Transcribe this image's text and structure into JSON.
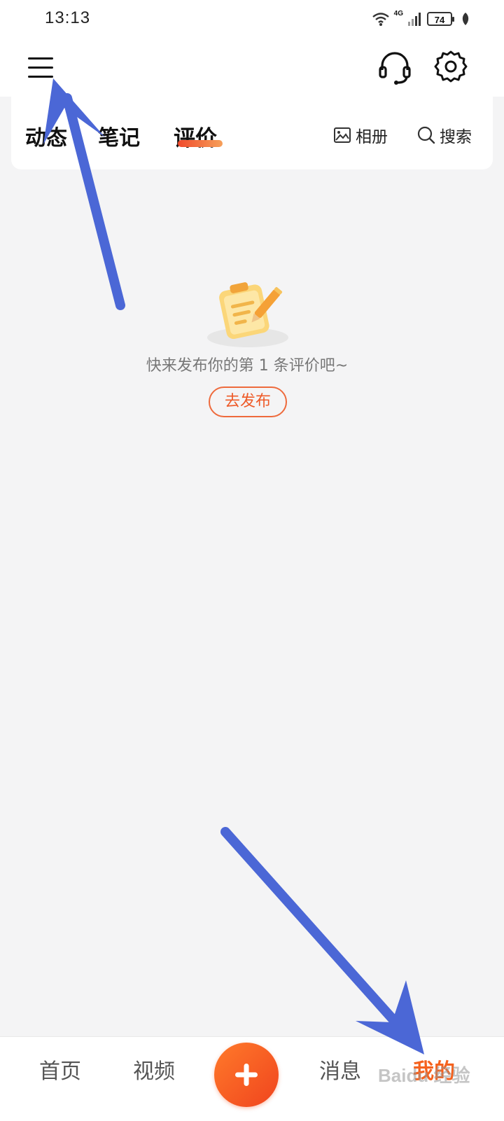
{
  "status_bar": {
    "time": "13:13",
    "network": "4G",
    "battery": "74"
  },
  "header": {
    "menu_icon": "menu-icon",
    "support_icon": "headset-icon",
    "settings_icon": "gear-icon"
  },
  "tabs": [
    {
      "label": "动态",
      "active": false
    },
    {
      "label": "笔记",
      "active": false
    },
    {
      "label": "评价",
      "active": true
    }
  ],
  "tools": {
    "album": "相册",
    "search": "搜索"
  },
  "empty_state": {
    "illustration": "clipboard-pencil-icon",
    "message": "快来发布你的第 1 条评价吧~",
    "button": "去发布"
  },
  "bottom_nav": [
    {
      "label": "首页",
      "active": false
    },
    {
      "label": "视频",
      "active": false
    },
    {
      "label": "+",
      "active": false
    },
    {
      "label": "消息",
      "active": false
    },
    {
      "label": "我的",
      "active": true
    }
  ],
  "colors": {
    "accent": "#f5621e",
    "annotation_arrow": "#4b67d6",
    "background": "#f4f4f5"
  },
  "watermark": "Baidu 经验"
}
